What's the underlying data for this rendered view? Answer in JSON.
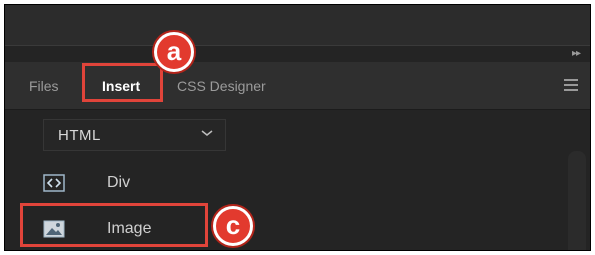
{
  "panel": {
    "tabs": [
      {
        "label": "Files",
        "active": false
      },
      {
        "label": "Insert",
        "active": true
      },
      {
        "label": "CSS Designer",
        "active": false
      }
    ],
    "menu_icon": "hamburger-menu-icon",
    "collapse_icon": "double-chevron-right-icon"
  },
  "category_dropdown": {
    "value": "HTML",
    "caret_icon": "chevron-down-icon"
  },
  "insert_items": [
    {
      "label": "Div",
      "icon": "div-code-icon"
    },
    {
      "label": "Image",
      "icon": "image-icon"
    }
  ],
  "annotations": {
    "badge_a": "a",
    "badge_c": "c"
  },
  "colors": {
    "panel_bg": "#242424",
    "tabbar_bg": "#2f2f2f",
    "annotation_red": "#e23a2e"
  }
}
